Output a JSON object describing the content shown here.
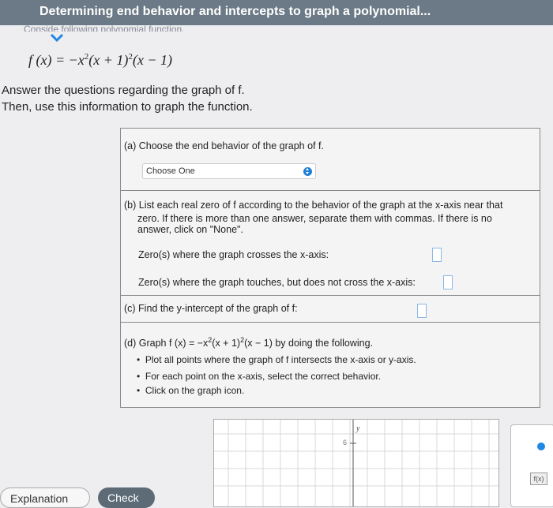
{
  "header": {
    "title": "Determining end behavior and intercepts to graph a polynomial...",
    "sub": "Conside       following polynomial function."
  },
  "problem": {
    "formula_lhs": "f (x) = −x",
    "formula_mid": "(x + 1)",
    "formula_end": "(x − 1)",
    "exp": "2",
    "line1": "Answer the questions regarding the graph of f.",
    "line2": "Then, use this information to graph the function."
  },
  "parts": {
    "a_label": "(a) Choose the end behavior of the graph of f.",
    "a_select": "Choose One",
    "b_line1": "(b) List each real zero of f according to the behavior of the graph at the x-axis near that",
    "b_line2": "zero. If there is more than one answer, separate them with commas. If there is no",
    "b_line3": "answer, click on \"None\".",
    "b_cross": "Zero(s) where the graph crosses the x-axis:",
    "b_touch": "Zero(s) where the graph touches, but does not cross the x-axis:",
    "c_label": "(c) Find the y-intercept of the graph of f:",
    "d_label_pre": "(d) Graph f (x) = −x",
    "d_label_mid": "(x + 1)",
    "d_label_post": "(x − 1)  by doing the following.",
    "d_bullets": [
      "Plot all points where the graph of f intersects the x-axis or y-axis.",
      "For each point on the x-axis, select the correct behavior.",
      "Click on the graph icon."
    ]
  },
  "graph": {
    "y_label": "y",
    "tick_6": "6"
  },
  "tools": {
    "fx_label": "f(x)"
  },
  "buttons": {
    "explanation": "Explanation",
    "check": "Check"
  }
}
